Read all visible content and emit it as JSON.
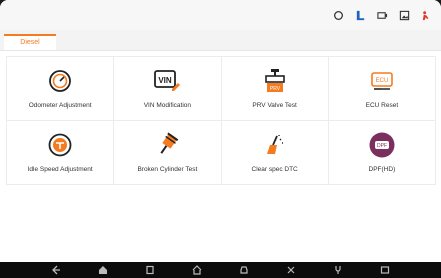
{
  "tab": {
    "label": "Diesel"
  },
  "colors": {
    "accent": "#f47b20",
    "icon_orange": "#f47b20",
    "dpf_purple": "#7a2f5e"
  },
  "functions": [
    {
      "label": "Odometer Adjustment",
      "icon": "odometer-icon"
    },
    {
      "label": "VIN Modification",
      "icon": "vin-icon"
    },
    {
      "label": "PRV Valve Test",
      "icon": "prv-valve-icon"
    },
    {
      "label": "ECU Reset",
      "icon": "ecu-icon"
    },
    {
      "label": "Idle Speed Adjustment",
      "icon": "idle-speed-icon"
    },
    {
      "label": "Broken Cylinder Test",
      "icon": "cylinder-icon"
    },
    {
      "label": "Clear spec DTC",
      "icon": "clear-dtc-icon"
    },
    {
      "label": "DPF(HD)",
      "icon": "dpf-icon"
    }
  ],
  "dpf_badge": "DPF",
  "ecu_text": "ECU",
  "vin_text": "VIN",
  "prv_text": "PRV"
}
